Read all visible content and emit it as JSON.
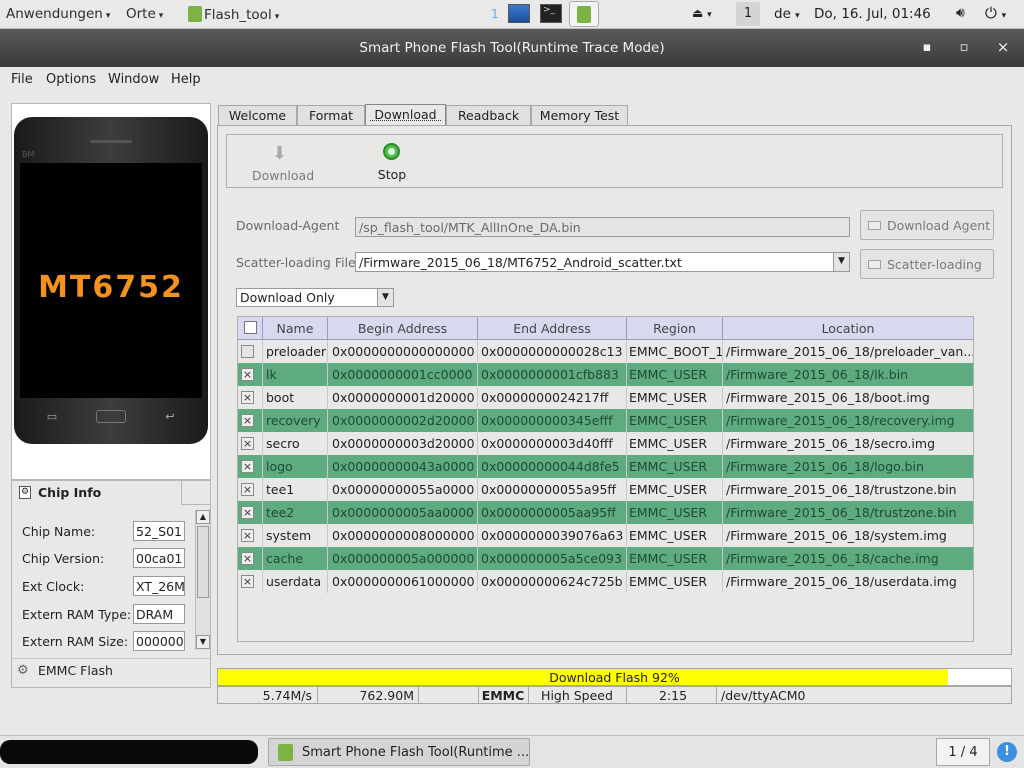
{
  "top_panel": {
    "applications": "Anwendungen",
    "places": "Orte",
    "task": "Flash_tool",
    "workspace_hint": "1",
    "workspace": "1",
    "keyboard": "de",
    "clock": "Do, 16. Jul, 01:46"
  },
  "window": {
    "title": "Smart Phone Flash Tool(Runtime Trace Mode)",
    "minimize": "▪",
    "maximize": "▫",
    "close": "×"
  },
  "menu": {
    "file": "File",
    "options": "Options",
    "window": "Window",
    "help": "Help"
  },
  "phone": {
    "chip": "MT6752",
    "brand": "BM"
  },
  "chip_info": {
    "title": "Chip Info",
    "rows": [
      {
        "label": "Chip Name:",
        "value": "52_S01"
      },
      {
        "label": "Chip Version:",
        "value": "00ca01"
      },
      {
        "label": "Ext Clock:",
        "value": "XT_26M"
      },
      {
        "label": "Extern RAM Type:",
        "value": "DRAM"
      },
      {
        "label": "Extern RAM Size:",
        "value": "000000"
      }
    ],
    "emmc": "EMMC Flash"
  },
  "tabs": [
    "Welcome",
    "Format",
    "Download",
    "Readback",
    "Memory Test"
  ],
  "active_tab": "Download",
  "toolbar": {
    "download": "Download",
    "stop": "Stop"
  },
  "download_agent": {
    "label": "Download-Agent",
    "value": "/sp_flash_tool/MTK_AllInOne_DA.bin",
    "button": "Download Agent"
  },
  "scatter": {
    "label": "Scatter-loading File",
    "value": "/Firmware_2015_06_18/MT6752_Android_scatter.txt",
    "button": "Scatter-loading"
  },
  "mode": "Download Only",
  "table": {
    "headers": [
      "Name",
      "Begin Address",
      "End Address",
      "Region",
      "Location"
    ],
    "rows": [
      {
        "checked": false,
        "name": "preloader",
        "begin": "0x0000000000000000",
        "end": "0x0000000000028c13",
        "region": "EMMC_BOOT_1",
        "location": "/Firmware_2015_06_18/preloader_van..."
      },
      {
        "checked": true,
        "name": "lk",
        "begin": "0x0000000001cc0000",
        "end": "0x0000000001cfb883",
        "region": "EMMC_USER",
        "location": "/Firmware_2015_06_18/lk.bin"
      },
      {
        "checked": true,
        "name": "boot",
        "begin": "0x0000000001d20000",
        "end": "0x0000000024217ff",
        "region": "EMMC_USER",
        "location": "/Firmware_2015_06_18/boot.img"
      },
      {
        "checked": true,
        "name": "recovery",
        "begin": "0x0000000002d20000",
        "end": "0x000000000345efff",
        "region": "EMMC_USER",
        "location": "/Firmware_2015_06_18/recovery.img"
      },
      {
        "checked": true,
        "name": "secro",
        "begin": "0x0000000003d20000",
        "end": "0x0000000003d40fff",
        "region": "EMMC_USER",
        "location": "/Firmware_2015_06_18/secro.img"
      },
      {
        "checked": true,
        "name": "logo",
        "begin": "0x00000000043a0000",
        "end": "0x00000000044d8fe5",
        "region": "EMMC_USER",
        "location": "/Firmware_2015_06_18/logo.bin"
      },
      {
        "checked": true,
        "name": "tee1",
        "begin": "0x00000000055a0000",
        "end": "0x00000000055a95ff",
        "region": "EMMC_USER",
        "location": "/Firmware_2015_06_18/trustzone.bin"
      },
      {
        "checked": true,
        "name": "tee2",
        "begin": "0x0000000005aa0000",
        "end": "0x0000000005aa95ff",
        "region": "EMMC_USER",
        "location": "/Firmware_2015_06_18/trustzone.bin"
      },
      {
        "checked": true,
        "name": "system",
        "begin": "0x0000000008000000",
        "end": "0x0000000039076a63",
        "region": "EMMC_USER",
        "location": "/Firmware_2015_06_18/system.img"
      },
      {
        "checked": true,
        "name": "cache",
        "begin": "0x000000005a000000",
        "end": "0x000000005a5ce093",
        "region": "EMMC_USER",
        "location": "/Firmware_2015_06_18/cache.img"
      },
      {
        "checked": true,
        "name": "userdata",
        "begin": "0x0000000061000000",
        "end": "0x00000000624c725b",
        "region": "EMMC_USER",
        "location": "/Firmware_2015_06_18/userdata.img"
      }
    ]
  },
  "progress": {
    "text": "Download Flash 92%",
    "fraction": 0.92,
    "color": "#ffff00"
  },
  "status": {
    "speed": "5.74M/s",
    "size": "762.90M",
    "storage": "EMMC",
    "mode": "High Speed",
    "time": "2:15",
    "port": "/dev/ttyACM0"
  },
  "taskbar": {
    "window": "Smart Phone Flash Tool(Runtime ...",
    "pager": "1 / 4"
  },
  "colors": {
    "row_highlight": "#5eab80",
    "row_plain": "#e8e8e7"
  }
}
